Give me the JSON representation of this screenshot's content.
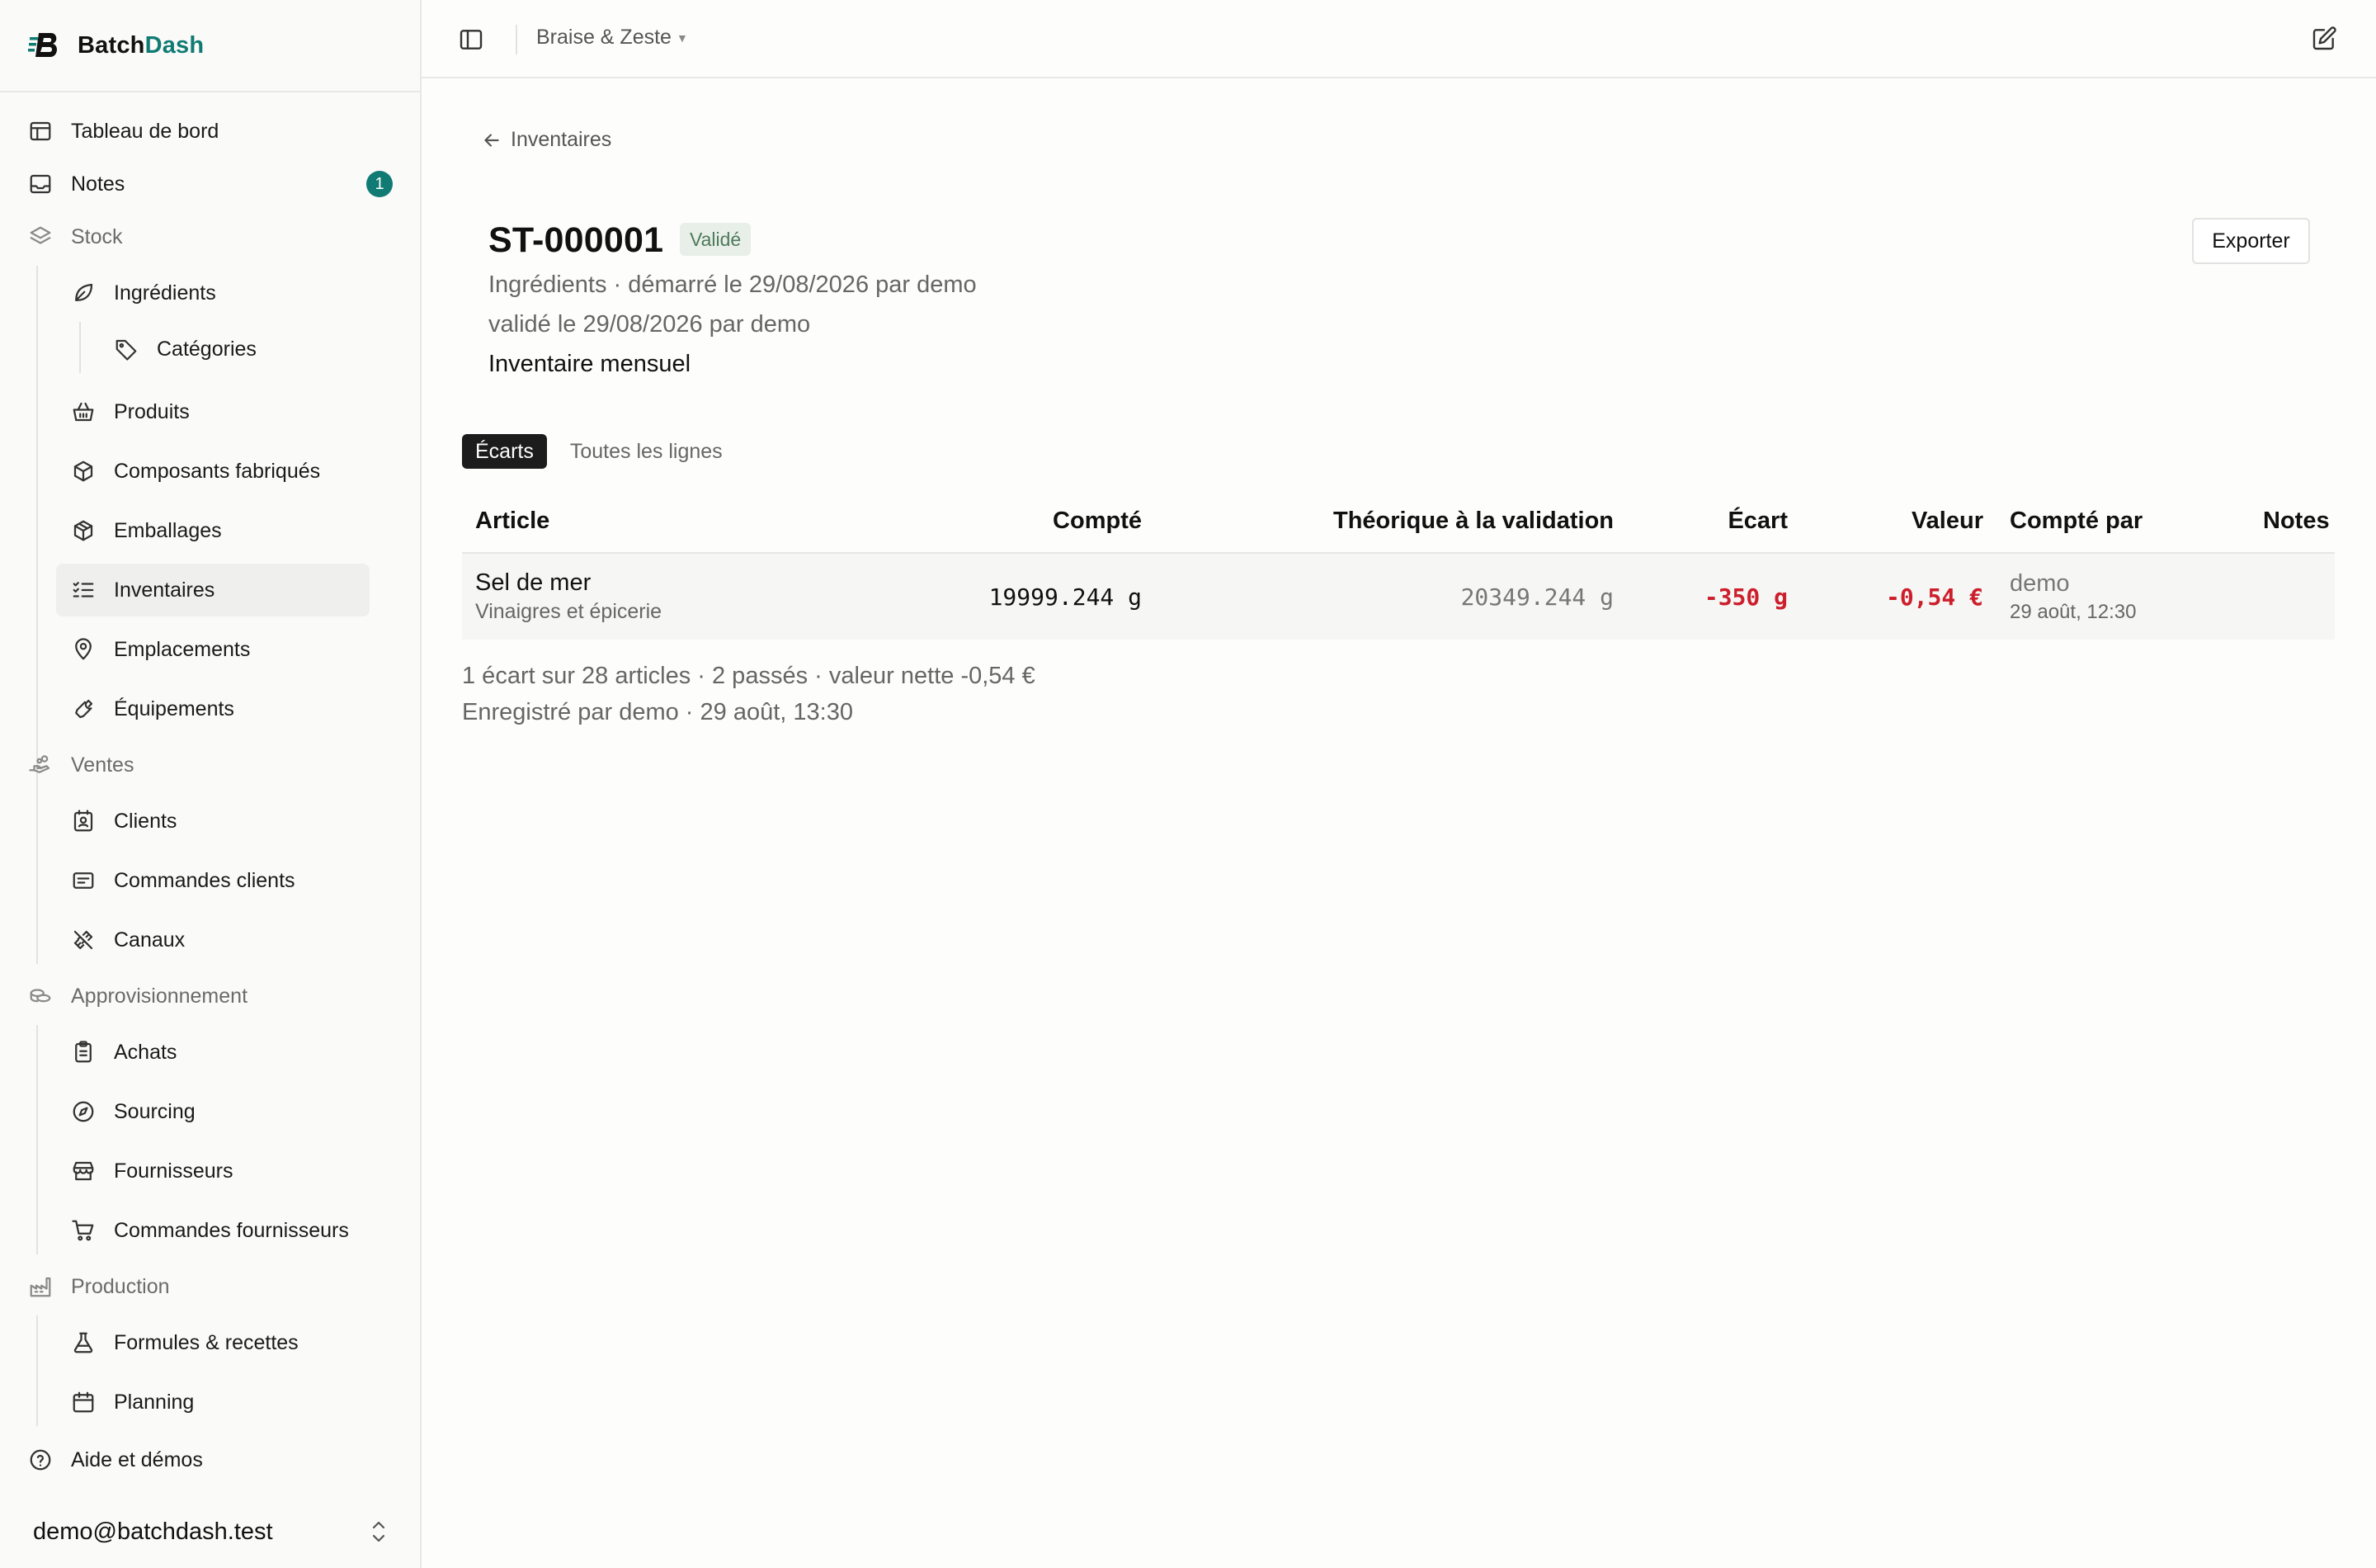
{
  "brand": {
    "name_main": "Batch",
    "name_accent": "Dash",
    "accent_color": "#0f7b73"
  },
  "sidebar": {
    "dashboard": "Tableau de bord",
    "notes": "Notes",
    "notes_badge": "1",
    "stock": "Stock",
    "ingredients": "Ingrédients",
    "categories": "Catégories",
    "produits": "Produits",
    "composants": "Composants fabriqués",
    "emballages": "Emballages",
    "inventaires": "Inventaires",
    "emplacements": "Emplacements",
    "equipements": "Équipements",
    "ventes": "Ventes",
    "clients": "Clients",
    "commandes_clients": "Commandes clients",
    "canaux": "Canaux",
    "approvisionnement": "Approvisionnement",
    "achats": "Achats",
    "sourcing": "Sourcing",
    "fournisseurs": "Fournisseurs",
    "commandes_fournisseurs": "Commandes fournisseurs",
    "production": "Production",
    "formules": "Formules & recettes",
    "planning": "Planning",
    "aide": "Aide et démos",
    "account_email": "demo@batchdash.test"
  },
  "topbar": {
    "workspace": "Braise & Zeste"
  },
  "page": {
    "back_label": "Inventaires",
    "title": "ST-000001",
    "status": "Validé",
    "meta_line1": "Ingrédients · démarré le 29/08/2026 par demo",
    "meta_line2": "validé le 29/08/2026 par demo",
    "description": "Inventaire mensuel",
    "export_label": "Exporter",
    "tabs": [
      "Écarts",
      "Toutes les lignes"
    ]
  },
  "table": {
    "headers": {
      "article": "Article",
      "compte": "Compté",
      "theorique": "Théorique à la validation",
      "ecart": "Écart",
      "valeur": "Valeur",
      "compte_par": "Compté par",
      "notes": "Notes"
    },
    "rows": [
      {
        "article": "Sel de mer",
        "category": "Vinaigres et épicerie",
        "compte": "19999.244 g",
        "theorique": "20349.244 g",
        "ecart": "-350 g",
        "valeur": "-0,54 €",
        "compte_par": "demo",
        "compte_le": "29 août, 12:30",
        "notes": ""
      }
    ]
  },
  "summary": {
    "line1": "1 écart sur 28 articles · 2 passés · valeur nette -0,54 €",
    "line2": "Enregistré par demo · 29 août, 13:30"
  }
}
